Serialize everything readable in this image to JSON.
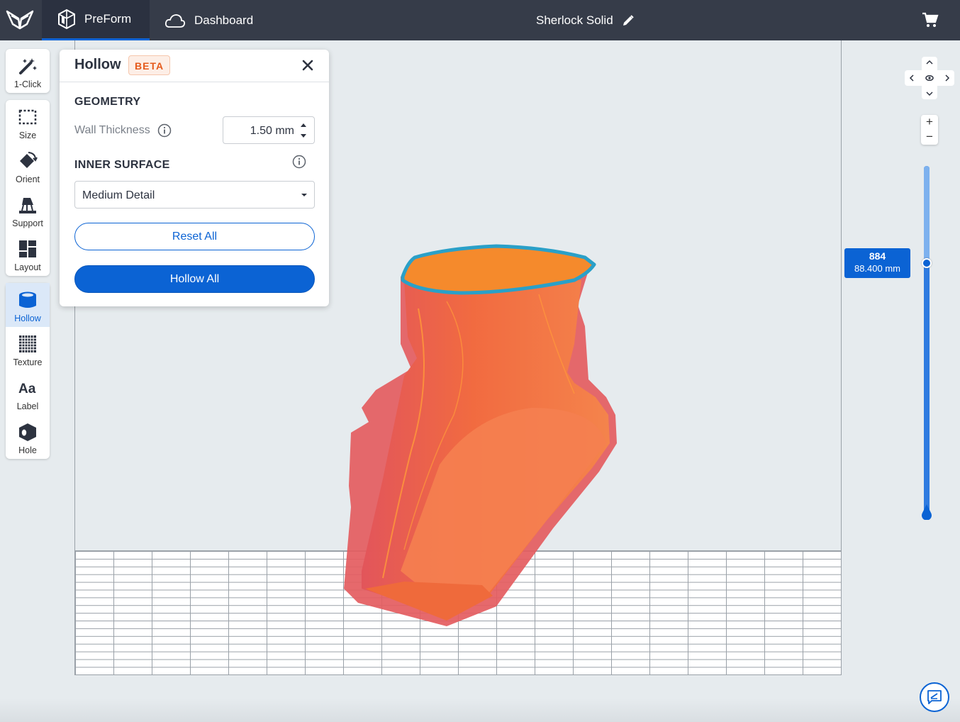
{
  "topbar": {
    "app_tab": "PreForm",
    "dashboard_tab": "Dashboard",
    "document_title": "Sherlock Solid",
    "icons": [
      "formlabs-logo-icon",
      "preform-cube-icon",
      "cloud-icon",
      "pencil-icon",
      "cart-icon"
    ]
  },
  "tools": {
    "one_click": "1-Click",
    "size": "Size",
    "orient": "Orient",
    "support": "Support",
    "layout": "Layout",
    "hollow": "Hollow",
    "texture": "Texture",
    "label": "Label",
    "hole": "Hole"
  },
  "hollow_panel": {
    "title": "Hollow",
    "badge": "BETA",
    "geometry_heading": "GEOMETRY",
    "wall_thickness_label": "Wall Thickness",
    "wall_thickness_value": "1.50 mm",
    "inner_surface_heading": "INNER SURFACE",
    "inner_surface_value": "Medium Detail",
    "reset_label": "Reset All",
    "hollow_label": "Hollow All"
  },
  "layer_slider": {
    "layer_number": "884",
    "layer_height": "88.400 mm"
  },
  "zoom": {
    "in": "+",
    "out": "−"
  },
  "colors": {
    "topbar": "#363c49",
    "accent": "#0b63d4",
    "beta": "#e55a1c",
    "model_fill": "#f07040",
    "model_edge": "#2aa0c8"
  }
}
